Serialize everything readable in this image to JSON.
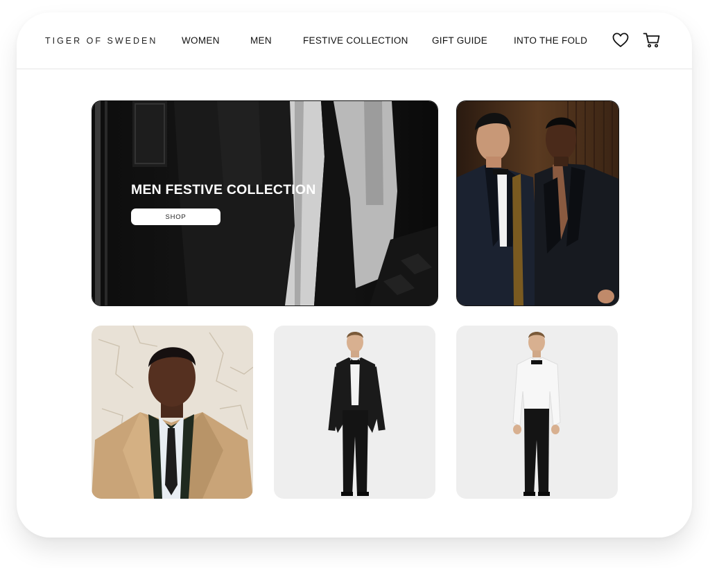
{
  "header": {
    "logo": "TIGER OF SWEDEN",
    "nav": [
      {
        "label": "WOMEN"
      },
      {
        "label": "MEN"
      },
      {
        "label": "FESTIVE COLLECTION"
      },
      {
        "label": "GIFT GUIDE"
      },
      {
        "label": "INTO THE FOLD"
      }
    ],
    "icons": [
      "heart-icon",
      "cart-icon"
    ]
  },
  "hero": {
    "title": "MEN FESTIVE COLLECTION",
    "shop_label": "SHOP"
  }
}
